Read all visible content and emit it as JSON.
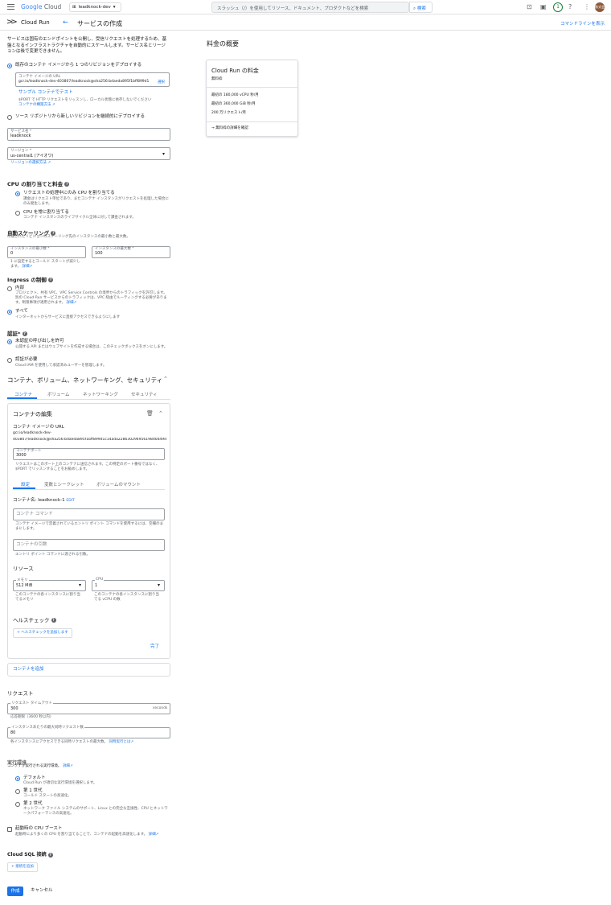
{
  "topbar": {
    "brand_google": "Google",
    "brand_cloud": "Cloud",
    "project": "leadknock-dev",
    "search_placeholder": "スラッシュ（/）を使用してリソース、ドキュメント、プロダクトなどを検索",
    "search_button": "検索",
    "notification_count": "1",
    "avatar_text": "株式会社"
  },
  "subbar": {
    "product": "Cloud Run",
    "page_title": "サービスの作成",
    "command_line": "コマンドラインを表示"
  },
  "intro": "サービスは固有のエンドポイントを公開し、受信リクエストを処理するため、基盤となるインフラストラクチャを自動的にスケールします。サービス名とリージョンは後で変更できません。",
  "deploy": {
    "option1": "既存のコンテナ イメージから 1 つのリビジョンをデプロイする",
    "image_label": "コンテナ イメージの URL",
    "image_value": "gcr.io/leadknock-dev-403807/leadknock@sha256:bdaeda895f1bff899d1",
    "select": "選択",
    "sample_link": "サンプル コンテナでテスト",
    "sample_hint": "$PORT で HTTP リクエストをリッスンし、ローカル状態に依存しないでください",
    "build_link": "コンテナの構築方法",
    "option2": "ソース リポジトリから新しいリビジョンを継続的にデプロイする"
  },
  "service_name": {
    "label": "サービス名 *",
    "value": "leadknock"
  },
  "region": {
    "label": "リージョン *",
    "value": "us-central1 (アイオワ)",
    "link": "リージョンの選択方法"
  },
  "cpu": {
    "title": "CPU の割り当てと料金",
    "opt1": "リクエストの処理中にのみ CPU を割り当てる",
    "opt1_desc": "課金はリクエスト単位であり、またコンテナ インスタンスがリクエストを処理した場合にのみ発生します。",
    "opt2": "CPU を常に割り当てる",
    "opt2_desc": "コンテナ インスタンスのライフサイクル全体に対して課金されます。"
  },
  "autoscaling": {
    "title": "自動スケーリング",
    "desc": "作成されたリビジョンのスケーリング先のインスタンスの最小数と最大数。",
    "min_label": "インスタンスの最小数 *",
    "min_value": "0",
    "max_label": "インスタンスの最大数 *",
    "max_value": "100",
    "hint": "1 に設定するとコールド スタートが減少します。",
    "hint_link": "詳細"
  },
  "ingress": {
    "title": "Ingress の制御",
    "opt1": "内部",
    "opt1_desc": "プロジェクト、共有 VPC、VPC Service Controls の境界からのトラフィックを許可します。別の Cloud Run サービスからのトラフィックは、VPC 経由でルーティングする必要があります。制限事項が適用されます。",
    "opt1_link": "詳細",
    "opt2": "すべて",
    "opt2_desc": "インターネットからサービスに直接アクセスできるようにします"
  },
  "auth": {
    "title": "認証*",
    "opt1": "未認証の呼び出しを許可",
    "opt1_desc": "公開する API またはウェブサイトを作成する場合は、このチェックボックスをオンにします。",
    "opt2": "認証が必要",
    "opt2_desc": "Cloud IAM を使用して承認済みユーザーを管理します。"
  },
  "containers_section": {
    "title": "コンテナ、ボリューム、ネットワーキング、セキュリティ",
    "tabs": [
      "コンテナ",
      "ボリューム",
      "ネットワーキング",
      "セキュリティ"
    ]
  },
  "container_edit": {
    "title": "コンテナの編集",
    "image_label": "コンテナ イメージの URL",
    "image_line1": "gcr.io/leadknock-dev-",
    "image_line2": "403807/leadknock@sha256:bdaeda895f1bff899d1c14ada228630294956198d0d49d",
    "port_label": "コンテナポート",
    "port_value": "3000",
    "port_hint": "リクエストはこのポート上のコンテナに送信されます。この特定のポート番号ではなく、$PORT でリッスンすることをお勧めします。",
    "subtabs": [
      "設定",
      "変数とシークレット",
      "ボリュームのマウント"
    ],
    "name_label": "コンテナ名: leadknock-1",
    "edit": "EDIT",
    "command_placeholder": "コンテナ コマンド",
    "command_hint": "コンテナ イメージで定義されているエントリ ポイント コマンドを使用するには、空欄のままにします。",
    "args_placeholder": "コンテナの引数",
    "args_hint": "エントリ ポイント コマンドに渡される引数。",
    "resources_title": "リソース",
    "memory_label": "メモリ",
    "memory_value": "512 MiB",
    "memory_hint": "このコンテナの各インスタンスに割り当てるメモリ",
    "cpu_label": "CPU",
    "cpu_value": "1",
    "cpu_hint": "このコンテナの各インスタンスに割り当てる vCPU の数",
    "health_title": "ヘルスチェック",
    "health_button": "ヘルスチェックを追加します",
    "done": "完了"
  },
  "add_container": "コンテナを追加",
  "requests": {
    "title": "リクエスト",
    "timeout_label": "リクエスト タイムアウト",
    "timeout_value": "300",
    "timeout_suffix": "seconds",
    "timeout_hint": "応答期限（3600 秒以内）",
    "concurrency_label": "インスタンスあたりの最大同時リクエスト数",
    "concurrency_value": "80",
    "concurrency_hint": "各インスタンスにアクセスできる同時リクエストの最大数。",
    "concurrency_link": "同時実行とは"
  },
  "execution": {
    "title": "実行環境",
    "desc": "コンテナが実行される実行環境。",
    "desc_link": "詳細",
    "opt1": "デフォルト",
    "opt1_desc": "Cloud Run が適切な実行環境を選択します。",
    "opt2": "第 1 世代",
    "opt2_desc": "コールド スタートの高速化。",
    "opt3": "第 2 世代",
    "opt3_desc": "ネットワーク ファイル システムのサポート、Linux との完全な互換性、CPU とネットワークパフォーマンスの高速化。"
  },
  "cpu_boost": {
    "title": "起動時の CPU ブースト",
    "desc": "起動時により多くの CPU を割り当てることで、コンテナの起動を高速化します。",
    "link": "詳細"
  },
  "cloudsql": {
    "title": "Cloud SQL 接続",
    "add": "接続を追加"
  },
  "actions": {
    "create": "作成",
    "cancel": "キャンセル"
  },
  "pricing": {
    "title": "料金の概要",
    "card_title": "Cloud Run の料金",
    "free": "無料枠",
    "lines": [
      "最初の 180,000 vCPU 秒/月",
      "最初の 360,000 GiB 秒/月",
      "200 万リクエスト/月"
    ],
    "link": "無料枠の詳細を確認"
  }
}
